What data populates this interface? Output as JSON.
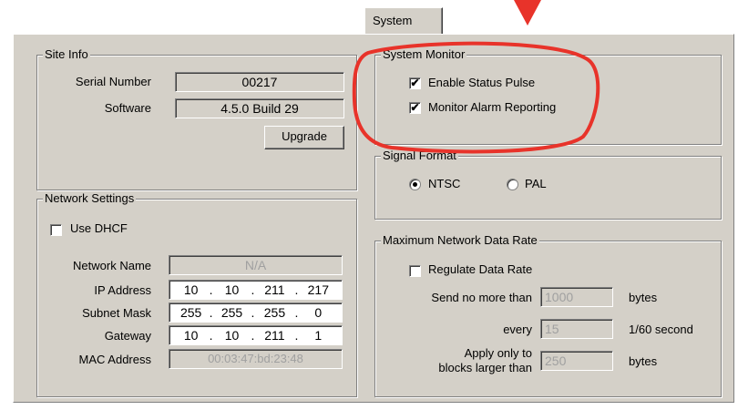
{
  "tab": {
    "label": "System"
  },
  "site_info": {
    "title": "Site Info",
    "serial_label": "Serial Number",
    "serial_value": "00217",
    "software_label": "Software",
    "software_value": "4.5.0 Build 29",
    "upgrade_label": "Upgrade"
  },
  "network": {
    "title": "Network Settings",
    "dhcp_label": "Use DHCF",
    "dhcp_checked": false,
    "name_label": "Network Name",
    "name_value": "N/A",
    "ip_label": "IP Address",
    "ip": [
      "10",
      "10",
      "211",
      "217"
    ],
    "mask_label": "Subnet Mask",
    "mask": [
      "255",
      "255",
      "255",
      "0"
    ],
    "gateway_label": "Gateway",
    "gateway": [
      "10",
      "10",
      "211",
      "1"
    ],
    "mac_label": "MAC Address",
    "mac_value": "00:03:47:bd:23:48",
    "dot": "."
  },
  "system_monitor": {
    "title": "System Monitor",
    "status_pulse_label": "Enable Status Pulse",
    "status_pulse_checked": true,
    "alarm_label": "Monitor Alarm Reporting",
    "alarm_checked": true,
    "check_mark": "✔"
  },
  "signal_format": {
    "title": "Signal Format",
    "ntsc_label": "NTSC",
    "pal_label": "PAL",
    "selected": "NTSC"
  },
  "data_rate": {
    "title": "Maximum Network Data Rate",
    "regulate_label": "Regulate Data Rate",
    "regulate_checked": false,
    "send_label": "Send no more than",
    "send_value": "1000",
    "send_unit": "bytes",
    "every_label": "every",
    "every_value": "15",
    "every_unit": "1/60 second",
    "apply_label_1": "Apply only to",
    "apply_label_2": "blocks larger than",
    "apply_value": "250",
    "apply_unit": "bytes"
  },
  "colors": {
    "panel": "#d4d0c8",
    "highlight_annotation": "#e8332a"
  }
}
